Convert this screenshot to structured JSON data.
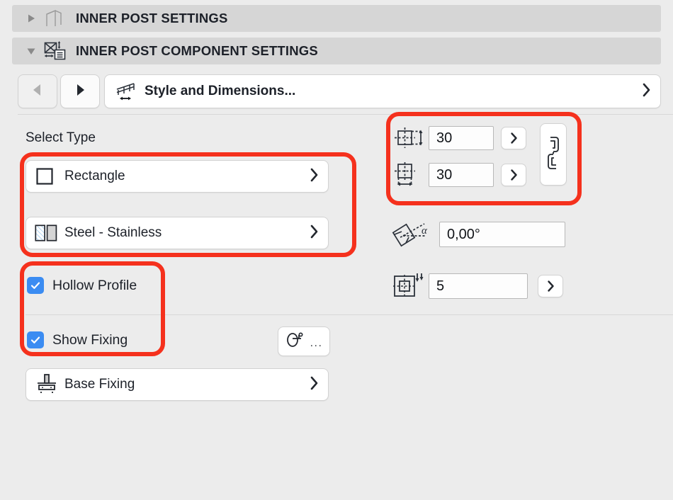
{
  "sections": [
    {
      "title": "INNER POST SETTINGS",
      "expanded": false,
      "triangle": "collapsed-triangle-icon",
      "icon": "post-frame-icon"
    },
    {
      "title": "INNER POST COMPONENT SETTINGS",
      "expanded": true,
      "triangle": "expanded-triangle-icon",
      "icon": "component-settings-icon"
    }
  ],
  "nav": {
    "prev_icon": "previous-arrow-icon",
    "next_icon": "next-arrow-icon",
    "field_icon": "railing-dimensions-icon",
    "field_label": "Style and Dimensions...",
    "chevron_icon": "chevron-right-icon"
  },
  "left": {
    "select_type_label": "Select Type",
    "shape_row": {
      "icon": "rectangle-profile-icon",
      "label": "Rectangle",
      "chevron": "chevron-right-icon"
    },
    "material_row": {
      "icon": "material-swatch-icon",
      "label": "Steel - Stainless",
      "chevron": "chevron-right-icon"
    },
    "hollow_profile": {
      "label": "Hollow Profile",
      "checked": true,
      "icon": "checkbox-checked-icon"
    },
    "show_fixing": {
      "label": "Show Fixing",
      "checked": true,
      "icon": "checkbox-checked-icon"
    },
    "fixing_detail_button": {
      "icon": "screw-fixing-icon",
      "label": "..."
    },
    "base_fixing_row": {
      "icon": "base-plate-fixing-icon",
      "label": "Base Fixing",
      "chevron": "chevron-right-icon"
    }
  },
  "right": {
    "height": {
      "icon": "profile-height-icon",
      "value": "30",
      "stepper_icon": "chevron-right-icon"
    },
    "width": {
      "icon": "profile-width-icon",
      "value": "30",
      "stepper_icon": "chevron-right-icon"
    },
    "link_button": {
      "icon": "chain-link-icon"
    },
    "angle": {
      "icon": "rotation-angle-icon",
      "value": "0,00°"
    },
    "quantity": {
      "icon": "profile-offset-icon",
      "value": "5",
      "stepper_icon": "chevron-right-icon"
    }
  },
  "annotations": [
    {
      "name": "select-type-highlight",
      "color": "#f5311d"
    },
    {
      "name": "checkboxes-highlight",
      "color": "#f5311d"
    },
    {
      "name": "dimensions-highlight",
      "color": "#f5311d"
    }
  ],
  "colors": {
    "background": "#ececec",
    "header_bar": "#d6d6d6",
    "checkbox_blue": "#3b8cf2",
    "annotation_red": "#f5311d",
    "icon_dark": "#2b313a"
  }
}
